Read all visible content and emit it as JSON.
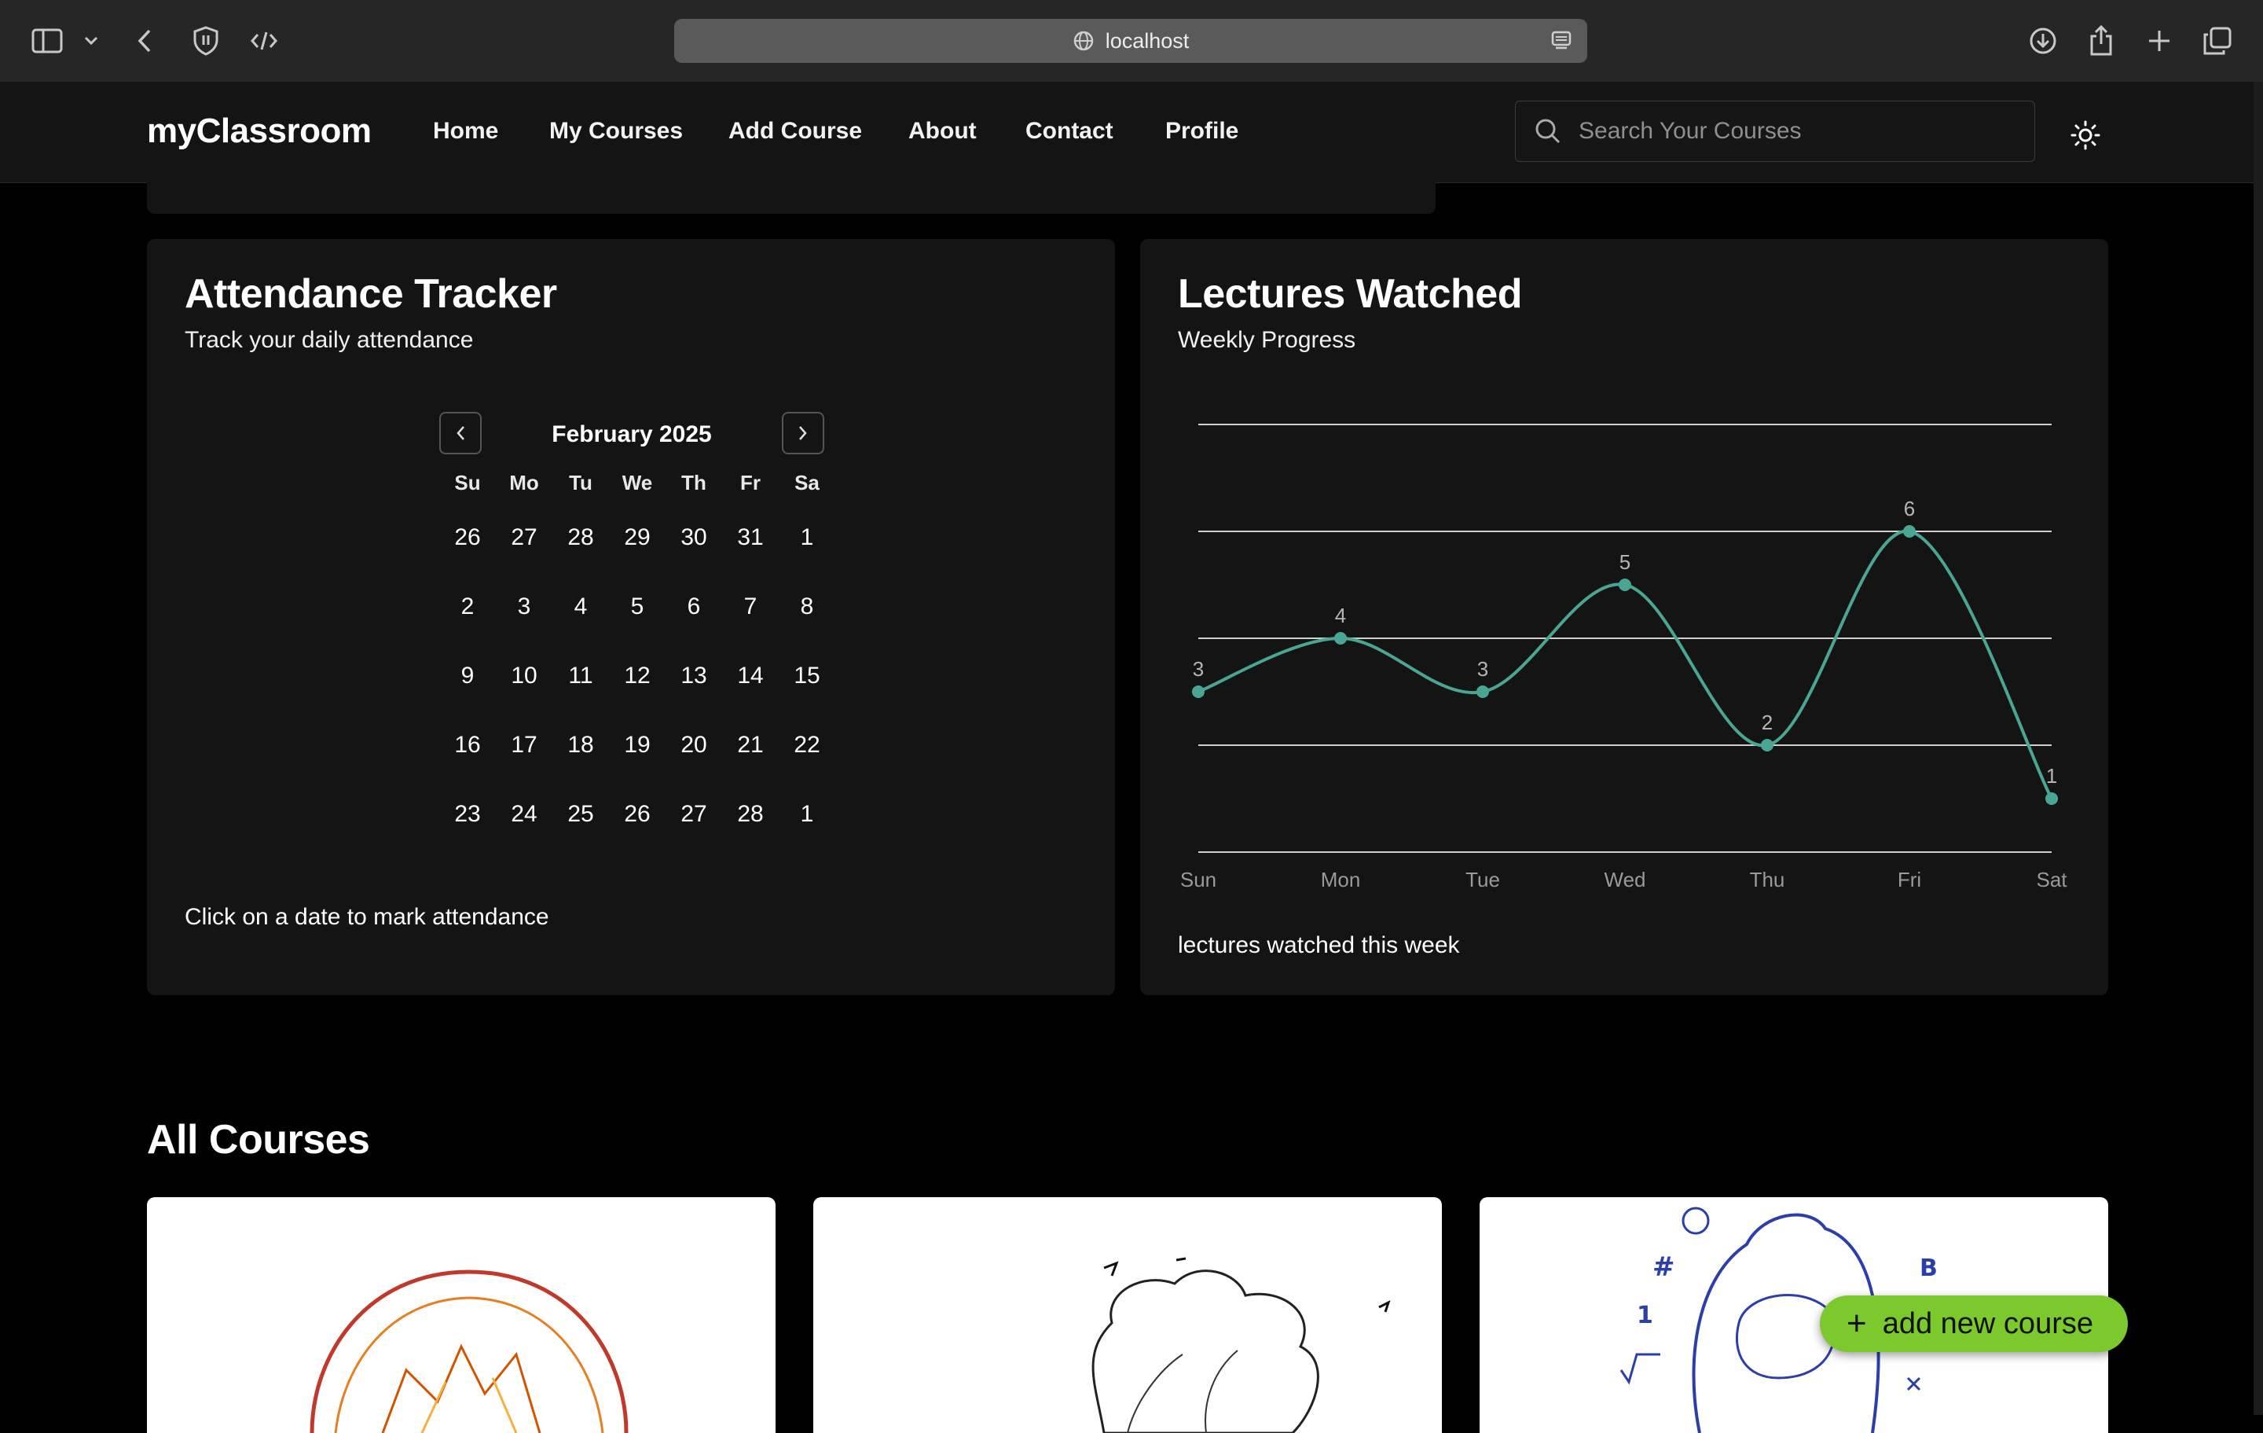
{
  "browser": {
    "url": "localhost"
  },
  "nav": {
    "brand": "myClassroom",
    "links": [
      "Home",
      "My Courses",
      "Add Course",
      "About",
      "Contact",
      "Profile"
    ],
    "active": "Home",
    "search_placeholder": "Search Your Courses"
  },
  "attendance": {
    "title": "Attendance Tracker",
    "subtitle": "Track your daily attendance",
    "month": "February 2025",
    "weekdays": [
      "Su",
      "Mo",
      "Tu",
      "We",
      "Th",
      "Fr",
      "Sa"
    ],
    "weeks": [
      [
        "26",
        "27",
        "28",
        "29",
        "30",
        "31",
        "1"
      ],
      [
        "2",
        "3",
        "4",
        "5",
        "6",
        "7",
        "8"
      ],
      [
        "9",
        "10",
        "11",
        "12",
        "13",
        "14",
        "15"
      ],
      [
        "16",
        "17",
        "18",
        "19",
        "20",
        "21",
        "22"
      ],
      [
        "23",
        "24",
        "25",
        "26",
        "27",
        "28",
        "1"
      ]
    ],
    "footer": "Click on a date to mark attendance"
  },
  "lectures": {
    "title": "Lectures Watched",
    "subtitle": "Weekly Progress",
    "footer": "lectures watched this week"
  },
  "chart_data": {
    "type": "line",
    "categories": [
      "Sun",
      "Mon",
      "Tue",
      "Wed",
      "Thu",
      "Fri",
      "Sat"
    ],
    "values": [
      3,
      4,
      3,
      5,
      2,
      6,
      1
    ],
    "ylim": [
      0,
      8
    ],
    "grid": true,
    "data_labels": true,
    "color": "#4aa694"
  },
  "courses": {
    "title": "All Courses"
  },
  "fab": {
    "label": "add new course"
  },
  "colors": {
    "accent": "#7cc92d",
    "line": "#4aa694",
    "card": "#141414"
  }
}
